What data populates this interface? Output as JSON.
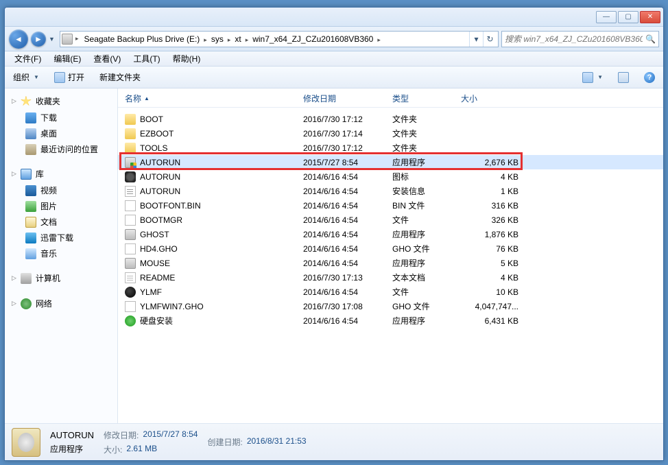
{
  "window_controls": {
    "min": "—",
    "max": "▢",
    "close": "✕"
  },
  "breadcrumb": {
    "drive_icon": "drive",
    "segs": [
      "Seagate Backup Plus Drive (E:)",
      "sys",
      "xt",
      "win7_x64_ZJ_CZu201608VB360"
    ]
  },
  "search": {
    "placeholder": "搜索 win7_x64_ZJ_CZu201608VB360"
  },
  "menu": {
    "file": "文件(F)",
    "edit": "编辑(E)",
    "view": "查看(V)",
    "tools": "工具(T)",
    "help": "帮助(H)"
  },
  "toolbar": {
    "organize": "组织",
    "open": "打开",
    "newfolder": "新建文件夹"
  },
  "sidebar": {
    "fav": {
      "label": "收藏夹",
      "items": [
        {
          "label": "下载",
          "ic": "ic-download"
        },
        {
          "label": "桌面",
          "ic": "ic-desktop"
        },
        {
          "label": "最近访问的位置",
          "ic": "ic-recent"
        }
      ]
    },
    "lib": {
      "label": "库",
      "items": [
        {
          "label": "视频",
          "ic": "ic-video"
        },
        {
          "label": "图片",
          "ic": "ic-pic"
        },
        {
          "label": "文档",
          "ic": "ic-doc"
        },
        {
          "label": "迅雷下载",
          "ic": "ic-thunder"
        },
        {
          "label": "音乐",
          "ic": "ic-music"
        }
      ]
    },
    "computer": {
      "label": "计算机"
    },
    "network": {
      "label": "网络"
    }
  },
  "columns": {
    "name": "名称",
    "modified": "修改日期",
    "type": "类型",
    "size": "大小"
  },
  "files": [
    {
      "name": "BOOT",
      "date": "2016/7/30 17:12",
      "type": "文件夹",
      "size": "",
      "fi": "fi-folder"
    },
    {
      "name": "EZBOOT",
      "date": "2016/7/30 17:14",
      "type": "文件夹",
      "size": "",
      "fi": "fi-folder"
    },
    {
      "name": "TOOLS",
      "date": "2016/7/30 17:12",
      "type": "文件夹",
      "size": "",
      "fi": "fi-folder"
    },
    {
      "name": "AUTORUN",
      "date": "2015/7/27 8:54",
      "type": "应用程序",
      "size": "2,676 KB",
      "fi": "fi-exe-shield",
      "selected": true,
      "highlight": true
    },
    {
      "name": "AUTORUN",
      "date": "2014/6/16 4:54",
      "type": "图标",
      "size": "4 KB",
      "fi": "fi-icon"
    },
    {
      "name": "AUTORUN",
      "date": "2014/6/16 4:54",
      "type": "安装信息",
      "size": "1 KB",
      "fi": "fi-ini"
    },
    {
      "name": "BOOTFONT.BIN",
      "date": "2014/6/16 4:54",
      "type": "BIN 文件",
      "size": "316 KB",
      "fi": "fi-file"
    },
    {
      "name": "BOOTMGR",
      "date": "2014/6/16 4:54",
      "type": "文件",
      "size": "326 KB",
      "fi": "fi-file"
    },
    {
      "name": "GHOST",
      "date": "2014/6/16 4:54",
      "type": "应用程序",
      "size": "1,876 KB",
      "fi": "fi-exe"
    },
    {
      "name": "HD4.GHO",
      "date": "2014/6/16 4:54",
      "type": "GHO 文件",
      "size": "76 KB",
      "fi": "fi-file"
    },
    {
      "name": "MOUSE",
      "date": "2014/6/16 4:54",
      "type": "应用程序",
      "size": "5 KB",
      "fi": "fi-exe"
    },
    {
      "name": "README",
      "date": "2016/7/30 17:13",
      "type": "文本文档",
      "size": "4 KB",
      "fi": "fi-txt"
    },
    {
      "name": "YLMF",
      "date": "2014/6/16 4:54",
      "type": "文件",
      "size": "10 KB",
      "fi": "fi-ylmf"
    },
    {
      "name": "YLMFWIN7.GHO",
      "date": "2016/7/30 17:08",
      "type": "GHO 文件",
      "size": "4,047,747...",
      "fi": "fi-file"
    },
    {
      "name": "硬盘安装",
      "date": "2014/6/16 4:54",
      "type": "应用程序",
      "size": "6,431 KB",
      "fi": "fi-green"
    }
  ],
  "details": {
    "name": "AUTORUN",
    "kind": "应用程序",
    "modified_label": "修改日期:",
    "modified_value": "2015/7/27 8:54",
    "size_label": "大小:",
    "size_value": "2.61 MB",
    "created_label": "创建日期:",
    "created_value": "2016/8/31 21:53"
  }
}
